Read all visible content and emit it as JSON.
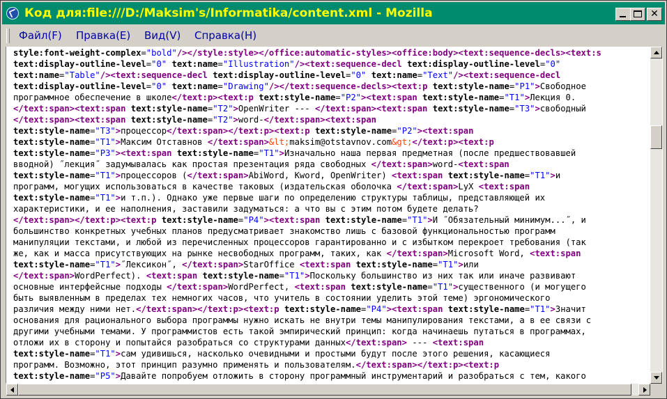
{
  "window": {
    "title": "Код для:file:///D:/Maksim's/Informatika/content.xml - Mozilla",
    "title_color": "#ffff00",
    "titlebar_color": "#008a6e"
  },
  "menu": {
    "items": [
      "Файл(F)",
      "Правка(E)",
      "Вид(V)",
      "Справка(H)"
    ]
  },
  "icons": {
    "app": "mozilla-app-icon",
    "minimize": "minimize-icon",
    "maximize": "maximize-icon",
    "close": "close-icon"
  },
  "syntax_colors": {
    "tag": "#800080",
    "attribute_value": "#0000ff",
    "entity": "#ff4000"
  },
  "source": {
    "lines": [
      "style:font-weight-complex=\"bold\"/></style:style></office:automatic-styles><office:body><text:sequence-decls><text:s",
      "text:display-outline-level=\"0\" text:name=\"Illustration\"/><text:sequence-decl text:display-outline-level=\"0\"",
      "text:name=\"Table\"/><text:sequence-decl text:display-outline-level=\"0\" text:name=\"Text\"/><text:sequence-decl",
      "text:display-outline-level=\"0\" text:name=\"Drawing\"/></text:sequence-decls><text:p text:style-name=\"P1\">Свободное",
      "программное обеспечение в школе</text:p><text:p text:style-name=\"P2\"><text:span text:style-name=\"T1\">Лекция 0.",
      "</text:span><text:span text:style-name=\"T2\">OpenWriter --- </text:span><text:span text:style-name=\"T3\">свободный",
      "</text:span><text:span text:style-name=\"T2\">word-</text:span><text:span",
      "text:style-name=\"T3\">процессор</text:span></text:p><text:p text:style-name=\"P2\"><text:span",
      "text:style-name=\"T1\">Максим Отставнов </text:span>&lt;maksim@otstavnov.com&gt;</text:p><text:p",
      "text:style-name=\"P3\"><text:span text:style-name=\"T1\">Изначально наша первая предметная (после предшествовавшей",
      "вводной) ˝лекция˝ задумывалась как простая презентация ряда свободных </text:span>word-<text:span",
      "text:style-name=\"T1\">процессоров (</text:span>AbiWord, Kword, OpenWriter) <text:span text:style-name=\"T1\">и",
      "программ, могущих использоваться в качестве таковых (издательская оболочка </text:span>LyX <text:span",
      "text:style-name=\"T1\">и т.п.). Однако уже первые шаги по определению структуры таблицы, представляющей их",
      "характеристики, и ее наполнения, заставили задуматься: а что вы с этим потом будете делать?",
      "</text:span></text:p><text:p text:style-name=\"P4\"><text:span text:style-name=\"T1\">И ˝Обязательный минимум...˝, и",
      "большинство конкретных учебных планов предусматривает знакомство лишь с базовой функциональностью программ",
      "манипуляции текстами, и любой из перечисленных процессоров гарантированно и с избытком перекроет требования (так",
      "же, как и масса присутствующих на рынке несвободных программ, таких, как </text:span>Microsoft Word, <text:span",
      "text:style-name=\"T1\">˝Лексикон˝, </text:span>StarOffice <text:span text:style-name=\"T1\">или",
      "</text:span>WordPerfect). <text:span text:style-name=\"T1\">Поскольку большинство из них так или иначе развивают",
      "основные интерфейсные подходы </text:span>WordPerfect, <text:span text:style-name=\"T1\">существенного (и могущего",
      "быть выявленным в пределах тех немногих часов, что учитель в состоянии уделить этой теме) эргономического",
      "различия между ними нет.</text:span></text:p><text:p text:style-name=\"P4\"><text:span text:style-name=\"T1\">Значит",
      "основания для рационального выбора программы нужно искать не внутри темы манипулирования текстами, а в ее связи с",
      "другими учебными темами. У программистов есть такой эмпирический принцип: когда начинаешь путаться в программах,",
      "отложи их в сторону и попытайся разобраться со структурами данных</text:span> --- <text:span",
      "text:style-name=\"T1\">сам удивишься, насколько очевидными и простыми будут после этого решения, касающиеся",
      "программ. Возможно, этот принцип разумно применять и пользователям.</text:span></text:p><text:p",
      "text:style-name=\"P5\">Давайте попробуем отложить в сторону программный инструментарий и разобраться с тем, какого"
    ]
  },
  "scrollbars": {
    "vertical_position": 0.23,
    "horizontal_position": 0.0
  }
}
